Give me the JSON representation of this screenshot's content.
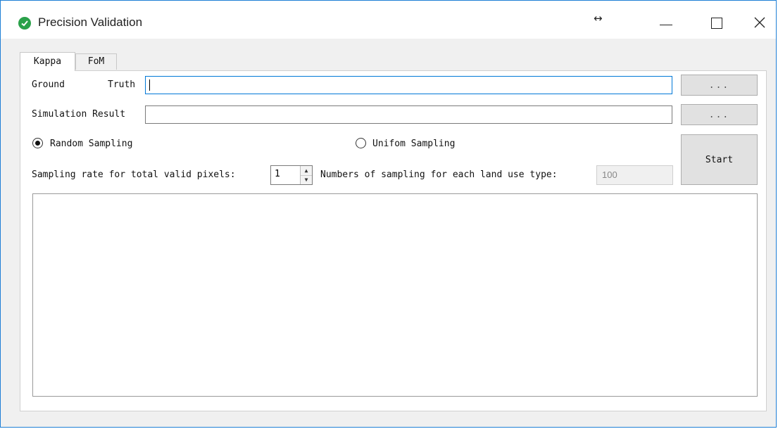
{
  "window": {
    "title": "Precision Validation",
    "resize_indicator": "↔",
    "controls": {
      "minimize": "—",
      "maximize": "☐",
      "close": "✕"
    }
  },
  "tabs": [
    {
      "label": "Kappa",
      "active": true
    },
    {
      "label": "FoM",
      "active": false
    }
  ],
  "form": {
    "ground_truth_label_1": "Ground",
    "ground_truth_label_2": "Truth",
    "ground_truth_value": "",
    "simulation_label": "Simulation Result",
    "simulation_value": "",
    "browse_label": "...",
    "random_sampling_label": "Random Sampling",
    "random_sampling_selected": true,
    "uniform_sampling_label": "Unifom Sampling",
    "uniform_sampling_selected": false,
    "sampling_rate_label": "Sampling rate for total valid pixels:",
    "sampling_rate_value": "1",
    "num_sampling_label": "Numbers of sampling for each land use type:",
    "num_sampling_value": "100",
    "start_label": "Start",
    "output_text": ""
  },
  "colors": {
    "accent": "#0078d7",
    "app_icon": "#2aa14a",
    "window_border": "#1e7fd6"
  },
  "icons": {
    "app": "check-circle-icon",
    "resize": "horizontal-arrows-icon",
    "spin_up": "triangle-up-icon",
    "spin_down": "triangle-down-icon"
  }
}
